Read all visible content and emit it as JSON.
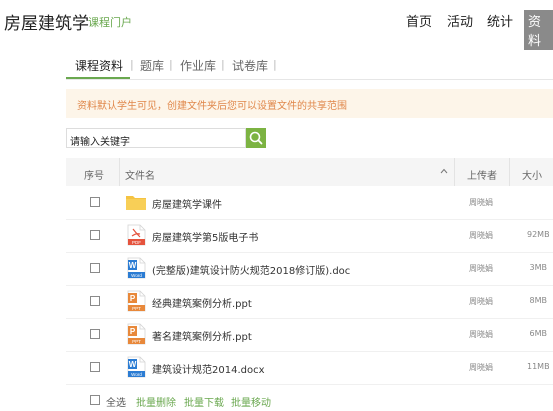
{
  "header": {
    "course_title": "房屋建筑学",
    "portal": "课程门户",
    "nav": [
      "首页",
      "活动",
      "统计",
      "资料"
    ]
  },
  "subtabs": [
    "课程资料",
    "题库",
    "作业库",
    "试卷库"
  ],
  "notice": "资料默认学生可见，创建文件夹后您可以设置文件的共享范围",
  "search": {
    "value": "请输入关键字"
  },
  "table": {
    "headers": {
      "index": "序号",
      "name": "文件名",
      "uploader": "上传者",
      "size": "大小"
    },
    "rows": [
      {
        "type": "folder",
        "icon": "folder-icon",
        "name": "房屋建筑学课件",
        "uploader": "周晓娟",
        "size": ""
      },
      {
        "type": "pdf",
        "icon": "pdf-icon",
        "label": "PDF",
        "name": "房屋建筑学第5版电子书",
        "uploader": "周晓娟",
        "size": "92MB"
      },
      {
        "type": "word",
        "icon": "word-icon",
        "label": "Word",
        "letter": "W",
        "name": "(完整版)建筑设计防火规范2018修订版).doc",
        "uploader": "周晓娟",
        "size": "3MB"
      },
      {
        "type": "ppt",
        "icon": "ppt-icon",
        "label": "PPT",
        "letter": "P",
        "name": "经典建筑案例分析.ppt",
        "uploader": "周晓娟",
        "size": "8MB"
      },
      {
        "type": "ppt",
        "icon": "ppt-icon",
        "label": "PPT",
        "letter": "P",
        "name": "著名建筑案例分析.ppt",
        "uploader": "周晓娟",
        "size": "6MB"
      },
      {
        "type": "word",
        "icon": "word-icon",
        "label": "Word",
        "letter": "W",
        "name": "建筑设计规范2014.docx",
        "uploader": "周晓娟",
        "size": "11MB"
      }
    ]
  },
  "footer": {
    "select_all": "全选",
    "actions": [
      "批量删除",
      "批量下载",
      "批量移动"
    ]
  },
  "colors": {
    "accent": "#6aa84f",
    "notice_text": "#e0874a",
    "notice_bg": "#fdf5e9",
    "pdf": "#e5533d",
    "word": "#2b7cd3",
    "ppt": "#e8883a",
    "folder": "#f5c342"
  }
}
